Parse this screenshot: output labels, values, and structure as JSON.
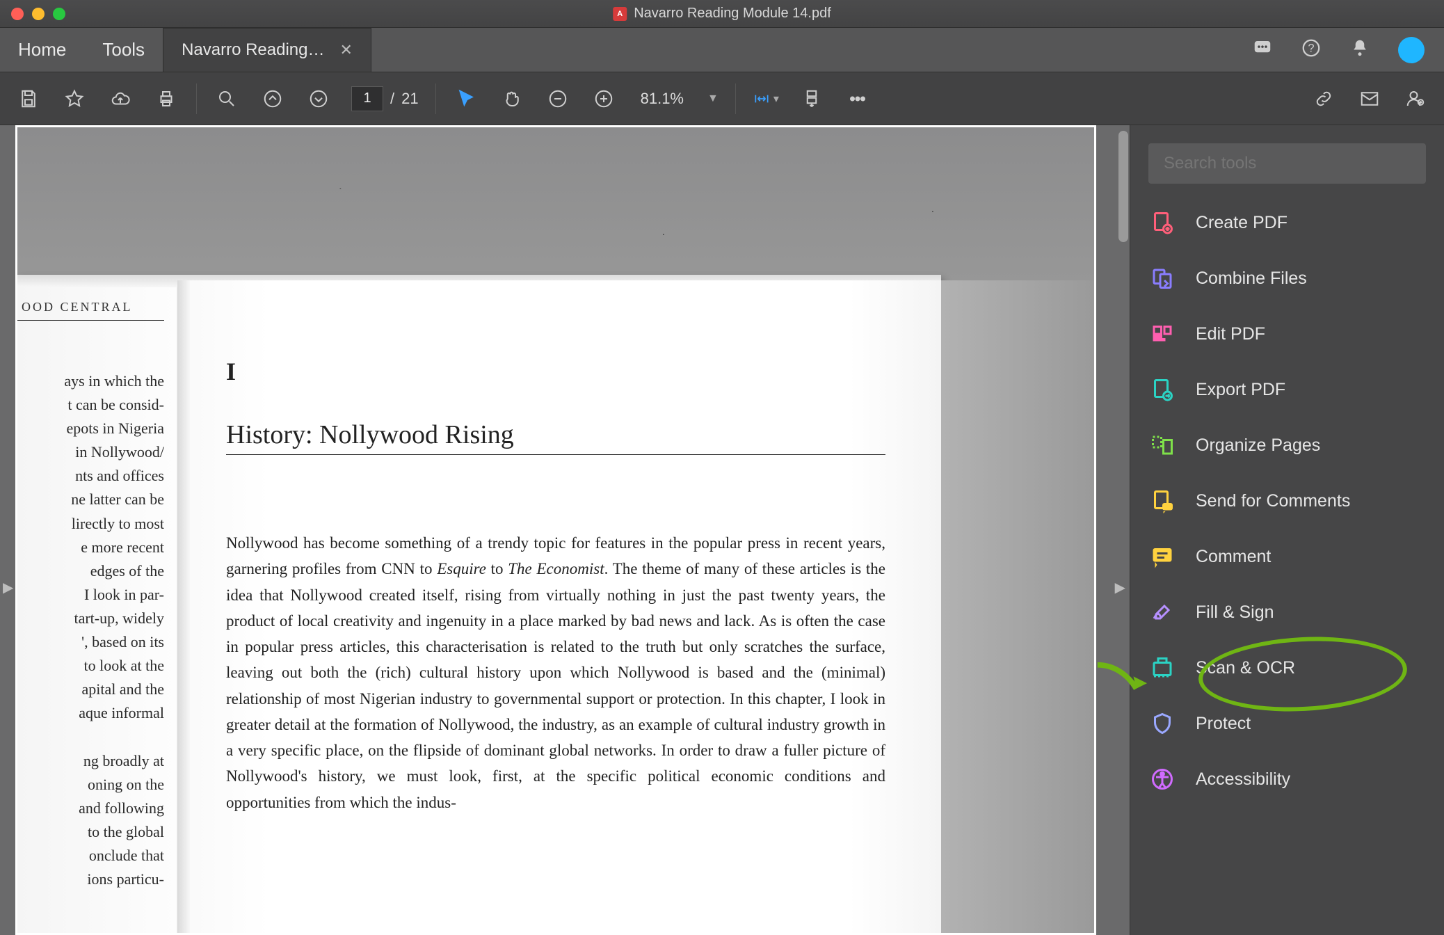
{
  "window": {
    "title": "Navarro Reading Module 14.pdf"
  },
  "tabs": {
    "home": "Home",
    "tools": "Tools",
    "file_label": "Navarro Reading…"
  },
  "toolbar": {
    "page_current": "1",
    "page_sep": "/",
    "page_total": "21",
    "zoom": "81.1%"
  },
  "tools_panel": {
    "search_placeholder": "Search tools",
    "items": [
      {
        "id": "create-pdf",
        "label": "Create PDF",
        "color": "#ff5f7a"
      },
      {
        "id": "combine-files",
        "label": "Combine Files",
        "color": "#8a7dff"
      },
      {
        "id": "edit-pdf",
        "label": "Edit PDF",
        "color": "#ff5fb0"
      },
      {
        "id": "export-pdf",
        "label": "Export PDF",
        "color": "#2bd3c4"
      },
      {
        "id": "organize-pages",
        "label": "Organize Pages",
        "color": "#7fe04a"
      },
      {
        "id": "send-for-comments",
        "label": "Send for Comments",
        "color": "#ffd23f"
      },
      {
        "id": "comment",
        "label": "Comment",
        "color": "#ffd23f"
      },
      {
        "id": "fill-sign",
        "label": "Fill & Sign",
        "color": "#b690ff"
      },
      {
        "id": "scan-ocr",
        "label": "Scan & OCR",
        "color": "#2bd3c4"
      },
      {
        "id": "protect",
        "label": "Protect",
        "color": "#9aa8ff"
      },
      {
        "id": "accessibility",
        "label": "Accessibility",
        "color": "#d06bff"
      }
    ]
  },
  "document": {
    "running_head_left": "OOD CENTRAL",
    "left_fragments": [
      "ays in which the",
      "t can be consid-",
      "epots in Nigeria",
      " in Nollywood/",
      "nts and offices",
      "ne latter can be",
      "lirectly to most",
      "e more recent",
      " edges of the",
      " I look in par-",
      "tart-up, widely",
      "', based on its",
      "to look at the",
      "apital and the",
      "aque informal",
      "",
      "ng broadly at",
      "oning on the",
      "and following",
      "to the global",
      "onclude that",
      "ions particu-"
    ],
    "chapter_number": "I",
    "chapter_title": "History: Nollywood Rising",
    "body_html": "Nollywood has become something of a trendy topic for features in the popular press in recent years, garnering profiles from CNN to <em>Esquire</em> to <em>The Economist</em>. The theme of many of these articles is the idea that Nollywood created itself, rising from virtually nothing in just the past twenty years, the product of local creativity and ingenuity in a place marked by bad news and lack. As is often the case in popular press articles, this characterisation is related to the truth but only scratches the surface, leaving out both the (rich) cultural history upon which Nollywood is based and the (minimal) relationship of most Nigerian industry to governmental support or protection. In this chapter, I look in greater detail at the formation of Nollywood, the industry, as an example of cultural industry growth in a very specific place, on the flipside of dominant global networks. In order to draw a fuller picture of Nollywood's history, we must look, first, at the specific political economic conditions and opportunities from which the indus-"
  }
}
